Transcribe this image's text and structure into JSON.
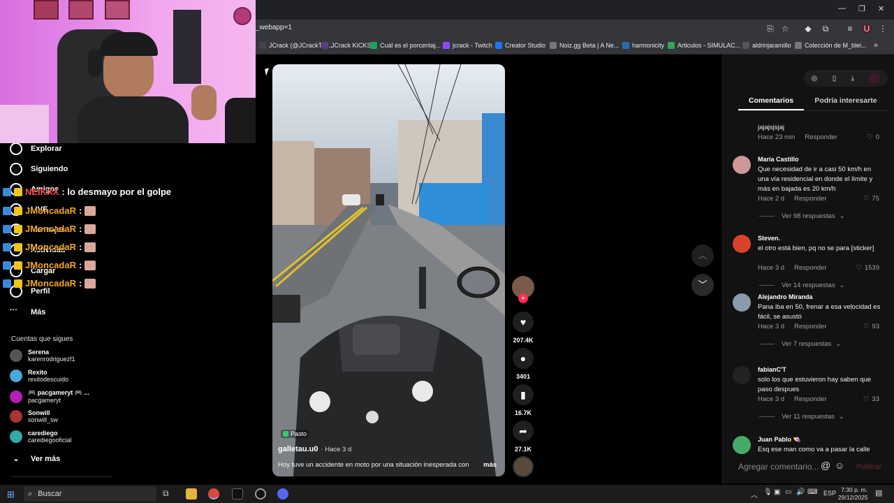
{
  "browser": {
    "url": "_webapp=1",
    "bookmarks": [
      {
        "label": "JCrack (@JCrackTV)...",
        "color": "#444"
      },
      {
        "label": "JCrack KICKS",
        "color": "#5a3d82"
      },
      {
        "label": "Cuál es el porcentaj...",
        "color": "#1aa260"
      },
      {
        "label": "jcrack - Twitch",
        "color": "#9146ff"
      },
      {
        "label": "Creator Studio",
        "color": "#1877f2"
      },
      {
        "label": "Noiz.gg Beta | A Ne...",
        "color": "#777"
      },
      {
        "label": "harmonicity",
        "color": "#2b6cb0"
      },
      {
        "label": "Articulos - SIMULAC...",
        "color": "#34a853"
      },
      {
        "label": "aldrinjaramillo",
        "color": "#555"
      },
      {
        "label": "Colección de M_blei...",
        "color": "#777"
      }
    ]
  },
  "sidebar": {
    "nav": [
      {
        "label": "Explorar",
        "icon": "compass-icon"
      },
      {
        "label": "Siguiendo",
        "icon": "following-icon"
      },
      {
        "label": "Amigos",
        "icon": "friends-icon"
      },
      {
        "label": "LIVE",
        "icon": "live-icon"
      },
      {
        "label": "Mensajes",
        "icon": "messages-icon"
      },
      {
        "label": "Actividad",
        "icon": "activity-icon"
      },
      {
        "label": "Cargar",
        "icon": "upload-icon"
      },
      {
        "label": "Perfil",
        "icon": "profile-icon"
      },
      {
        "label": "Más",
        "icon": "more-icon"
      }
    ],
    "following_title": "Cuentas que sigues",
    "following": [
      {
        "name": "Serena",
        "user": "karenrodriguezf1",
        "color": "#555"
      },
      {
        "name": "Rexito",
        "user": "rexitodescuido",
        "color": "#49a9d8"
      },
      {
        "name": "🎮 pacgameryt 🎮 ...",
        "user": "pacgameryt",
        "color": "#b41eb4"
      },
      {
        "name": "Sonwill",
        "user": "sonwill_sw",
        "color": "#a33"
      },
      {
        "name": "carediego",
        "user": "carediegooficial",
        "color": "#3aa"
      }
    ],
    "see_more": "Ver más"
  },
  "chat": [
    {
      "name": "NEIKXX",
      "message": ": lo desmayo por el golpe",
      "red": true
    },
    {
      "name": "JMoncadaR",
      "message": ":",
      "red": false
    },
    {
      "name": "JMoncadaR",
      "message": ":",
      "red": false
    },
    {
      "name": "JMoncadaR",
      "message": ":",
      "red": false
    },
    {
      "name": "JMoncadaR",
      "message": ":",
      "red": false
    },
    {
      "name": "JMoncadaR",
      "message": ":",
      "red": false
    }
  ],
  "video": {
    "location": "Pasto",
    "author": "galletau.u0",
    "time": "· Hace 3 d",
    "caption": "Hoy tuve un accidente en moto por una situación inesperada con",
    "more": "más",
    "likes": "207.4K",
    "comments": "3401",
    "saves": "16.7K",
    "shares": "27.1K"
  },
  "comments_panel": {
    "tabs": [
      "Comentarios",
      "Podría interesarte"
    ],
    "reply_label": "Responder",
    "items": [
      {
        "name": "",
        "text": "jajajsjsjaj",
        "time": "Hace 23 min",
        "likes": "0",
        "avatar_color": "",
        "more": ""
      },
      {
        "name": "Maria Castillo",
        "text": "Que necesidad de ir a casi 50 km/h en una vía residencial en donde el límite y más en bajada es 20 km/h",
        "time": "Hace 2 d",
        "likes": "75",
        "avatar_color": "#c99",
        "more": "Ver 98 respuestas"
      },
      {
        "name": "Steven.",
        "text": "el otro está bien, pq no se para [sticker]",
        "time": "Hace 3 d",
        "likes": "1539",
        "avatar_color": "#d9432b",
        "more": "Ver 14 respuestas"
      },
      {
        "name": "Alejandro Miranda",
        "text": "Pana iba en 50, frenar a esa velocidad es fácil, se asustó",
        "time": "Hace 3 d",
        "likes": "93",
        "avatar_color": "#8a9bb0",
        "more": "Ver 7 respuestas"
      },
      {
        "name": "fabianC'T",
        "text": "solo los que estuvieron hay saben que paso despues",
        "time": "Hace 3 d",
        "likes": "33",
        "avatar_color": "#222",
        "more": "Ver 11 respuestas"
      },
      {
        "name": "Juan Pablo 👒",
        "text": "Esq ese man como va a pasar la calle",
        "time": "",
        "likes": "",
        "avatar_color": "#4a6",
        "more": ""
      }
    ],
    "input_placeholder": "Agregar comentario...",
    "publish": "Publicar"
  },
  "taskbar": {
    "search": "Buscar",
    "lang": "ESP",
    "time": "7:30 p. m.",
    "date": "29/12/2025"
  }
}
